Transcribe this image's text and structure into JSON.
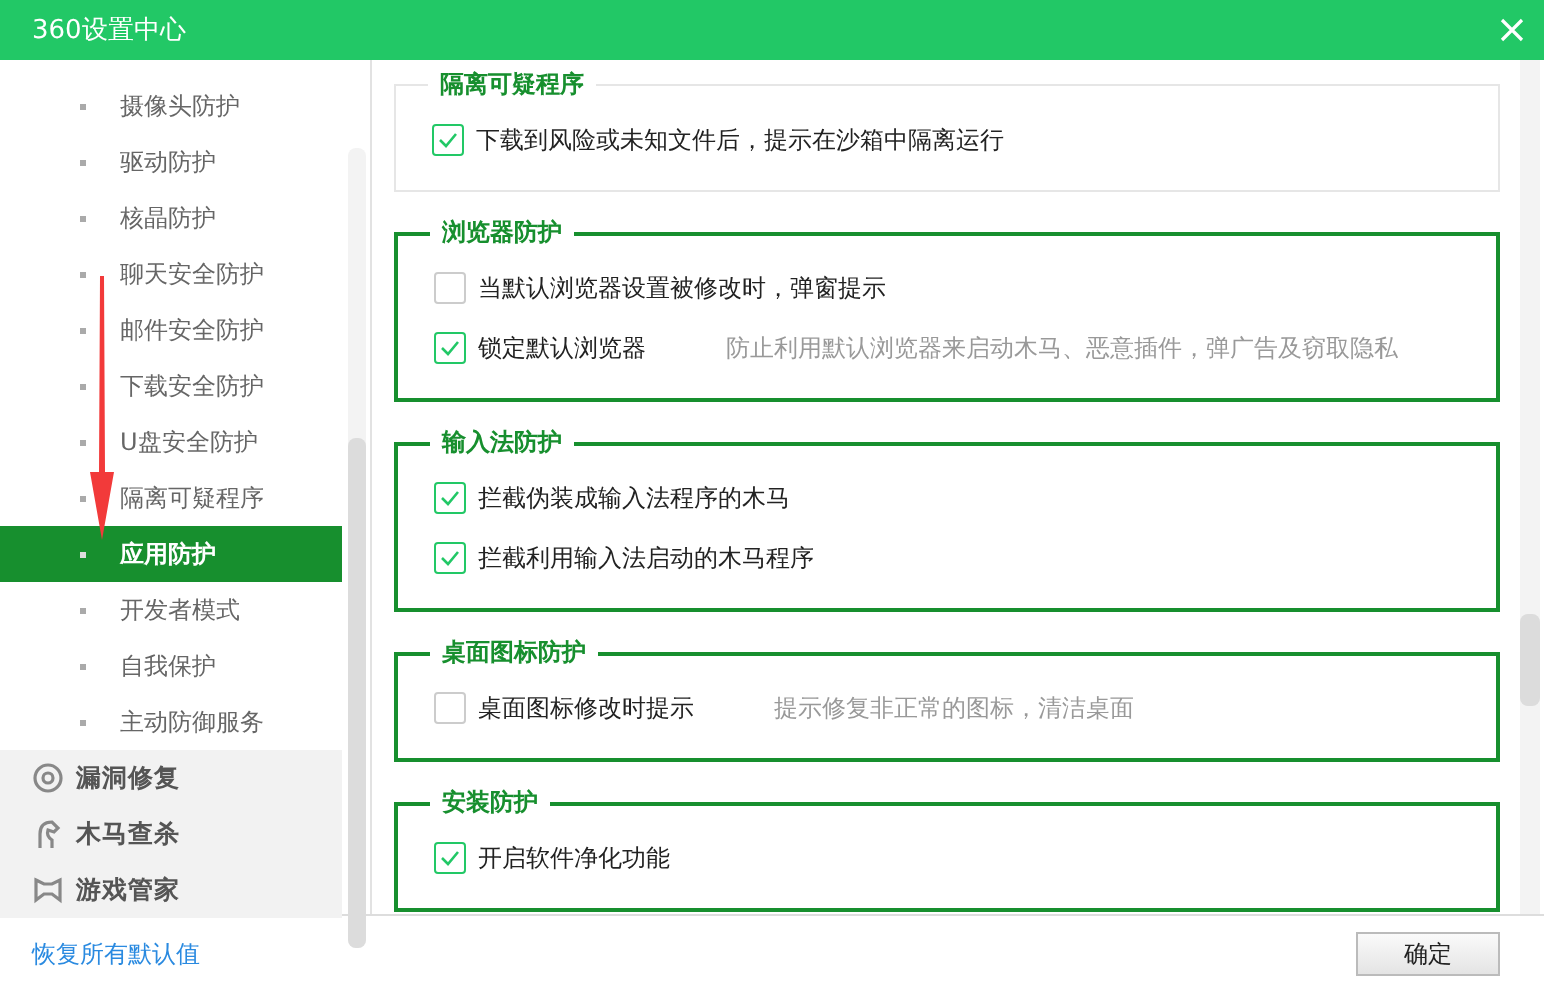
{
  "window": {
    "title": "360设置中心"
  },
  "sidebar": {
    "sub_items": [
      {
        "label": "摄像头防护",
        "selected": false
      },
      {
        "label": "驱动防护",
        "selected": false
      },
      {
        "label": "核晶防护",
        "selected": false
      },
      {
        "label": "聊天安全防护",
        "selected": false
      },
      {
        "label": "邮件安全防护",
        "selected": false
      },
      {
        "label": "下载安全防护",
        "selected": false
      },
      {
        "label": "U盘安全防护",
        "selected": false
      },
      {
        "label": "隔离可疑程序",
        "selected": false
      },
      {
        "label": "应用防护",
        "selected": true
      },
      {
        "label": "开发者模式",
        "selected": false
      },
      {
        "label": "自我保护",
        "selected": false
      },
      {
        "label": "主动防御服务",
        "selected": false
      }
    ],
    "groups": [
      {
        "label": "漏洞修复",
        "kind": "repair"
      },
      {
        "label": "木马查杀",
        "kind": "trojan"
      },
      {
        "label": "游戏管家",
        "kind": "game"
      }
    ]
  },
  "sections": [
    {
      "title": "隔离可疑程序",
      "highlighted": false,
      "options": [
        {
          "label": "下载到风险或未知文件后，提示在沙箱中隔离运行",
          "checked": true
        }
      ]
    },
    {
      "title": "浏览器防护",
      "highlighted": true,
      "options": [
        {
          "label": "当默认浏览器设置被修改时，弹窗提示",
          "checked": false
        },
        {
          "label": "锁定默认浏览器",
          "checked": true,
          "hint": "防止利用默认浏览器来启动木马、恶意插件，弹广告及窃取隐私"
        }
      ]
    },
    {
      "title": "输入法防护",
      "highlighted": true,
      "options": [
        {
          "label": "拦截伪装成输入法程序的木马",
          "checked": true
        },
        {
          "label": "拦截利用输入法启动的木马程序",
          "checked": true
        }
      ]
    },
    {
      "title": "桌面图标防护",
      "highlighted": true,
      "options": [
        {
          "label": "桌面图标修改时提示",
          "checked": false,
          "hint": "提示修复非正常的图标，清洁桌面"
        }
      ]
    },
    {
      "title": "安装防护",
      "highlighted": true,
      "options": [
        {
          "label": "开启软件净化功能",
          "checked": true
        }
      ]
    }
  ],
  "footer": {
    "restore_link": "恢复所有默认值",
    "ok_button": "确定"
  }
}
